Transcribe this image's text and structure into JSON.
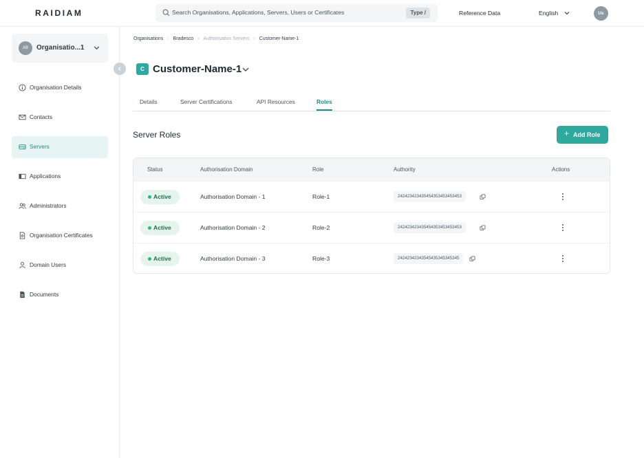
{
  "header": {
    "logo": "RAIDIAM",
    "search_placeholder": "Search Organisations, Applications, Servers, Users or Certificates",
    "search_shortcut": "Type /",
    "reference_data": "Reference Data",
    "language": "English",
    "user_initials": "Us"
  },
  "sidebar": {
    "org_initials": "AB",
    "org_name": "Organisatio...1",
    "items": [
      {
        "label": "Organisation Details",
        "icon": "info-icon"
      },
      {
        "label": "Contacts",
        "icon": "mail-icon"
      },
      {
        "label": "Servers",
        "icon": "server-icon",
        "active": true
      },
      {
        "label": "Applications",
        "icon": "applications-icon"
      },
      {
        "label": "Administrators",
        "icon": "users-icon"
      },
      {
        "label": "Organisation Certificates",
        "icon": "certificate-icon"
      },
      {
        "label": "Domain Users",
        "icon": "user-icon"
      },
      {
        "label": "Documents",
        "icon": "document-icon"
      }
    ]
  },
  "breadcrumb": [
    "Organisations",
    "Bradesco",
    "Authorisation Servers",
    "Customer-Name-1"
  ],
  "page": {
    "badge": "C",
    "title": "Customer-Name-1",
    "tabs": [
      "Details",
      "Server Certifications",
      "API Resources",
      "Roles"
    ],
    "active_tab": "Roles",
    "section_title": "Server Roles",
    "add_button": "Add Role"
  },
  "table": {
    "columns": [
      "Status",
      "Authorisation Domain",
      "Role",
      "Authority",
      "Actions"
    ],
    "rows": [
      {
        "status": "Active",
        "domain": "Authorisation Domain - 1",
        "role": "Role-1",
        "authority": "242423423435454353453453453"
      },
      {
        "status": "Active",
        "domain": "Authorisation Domain - 2",
        "role": "Role-2",
        "authority": "242423423435454353453453453"
      },
      {
        "status": "Active",
        "domain": "Authorisation Domain - 3",
        "role": "Role-3",
        "authority": "24242342343545435345345345"
      }
    ]
  },
  "colors": {
    "accent": "#2fa89e",
    "active_status": "#2cb67d"
  }
}
